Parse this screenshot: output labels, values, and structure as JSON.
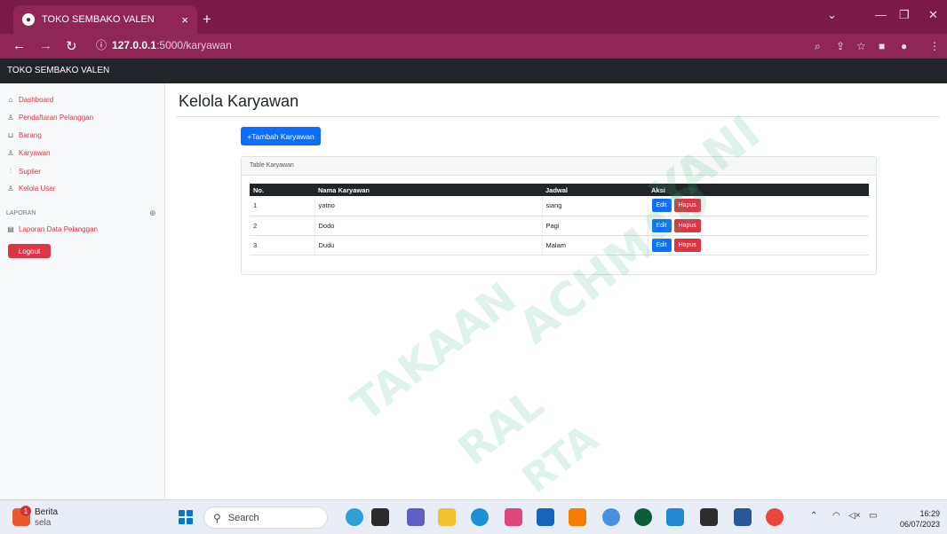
{
  "browser": {
    "tab_title": "TOKO SEMBAKO VALEN",
    "tab_close": "×",
    "new_tab": "+",
    "url_host": "127.0.0.1",
    "url_path": ":5000/karyawan"
  },
  "navbar": {
    "brand": "TOKO SEMBAKO VALEN"
  },
  "sidebar": {
    "items": [
      {
        "label": "Dashboard",
        "icon": "home-icon"
      },
      {
        "label": "Pendaftaran Pelanggan",
        "icon": "users-icon"
      },
      {
        "label": "Barang",
        "icon": "cart-icon"
      },
      {
        "label": "Karyawan",
        "icon": "users-icon"
      },
      {
        "label": "Suplier",
        "icon": "bar-chart-icon"
      },
      {
        "label": "Kelola User",
        "icon": "user-icon"
      }
    ],
    "report_heading": "LAPORAN",
    "report_items": [
      {
        "label": "Laporan Data Pelanggan",
        "icon": "document-icon"
      }
    ],
    "logout_label": "Logout"
  },
  "main": {
    "title": "Kelola Karyawan",
    "add_button": "+Tambah Karyawan",
    "card_header": "Table Karyawan",
    "table": {
      "headers": [
        "No.",
        "Nama Karyawan",
        "Jadwal",
        "Aksi"
      ],
      "rows": [
        {
          "no": "1",
          "nama": "yatno",
          "jadwal": "siang"
        },
        {
          "no": "2",
          "nama": "Dodo",
          "jadwal": "Pagi"
        },
        {
          "no": "3",
          "nama": "Dudu",
          "jadwal": "Malam"
        }
      ],
      "edit_label": "Edit",
      "hapus_label": "Hapus"
    }
  },
  "watermark": {
    "line1": "YANI",
    "line2": "ACHMAD",
    "line3": "TAKAAN",
    "line4": "RAL",
    "line5": "RTA"
  },
  "taskbar": {
    "news_badge": "1",
    "news_title": "Berita",
    "news_sub": "sela",
    "search_label": "Search",
    "time": "16:29",
    "date": "06/07/2023"
  },
  "colors": {
    "browser_frame": "#7a1a46",
    "navbar": "#212529",
    "primary": "#0d6efd",
    "danger": "#dc3545"
  }
}
